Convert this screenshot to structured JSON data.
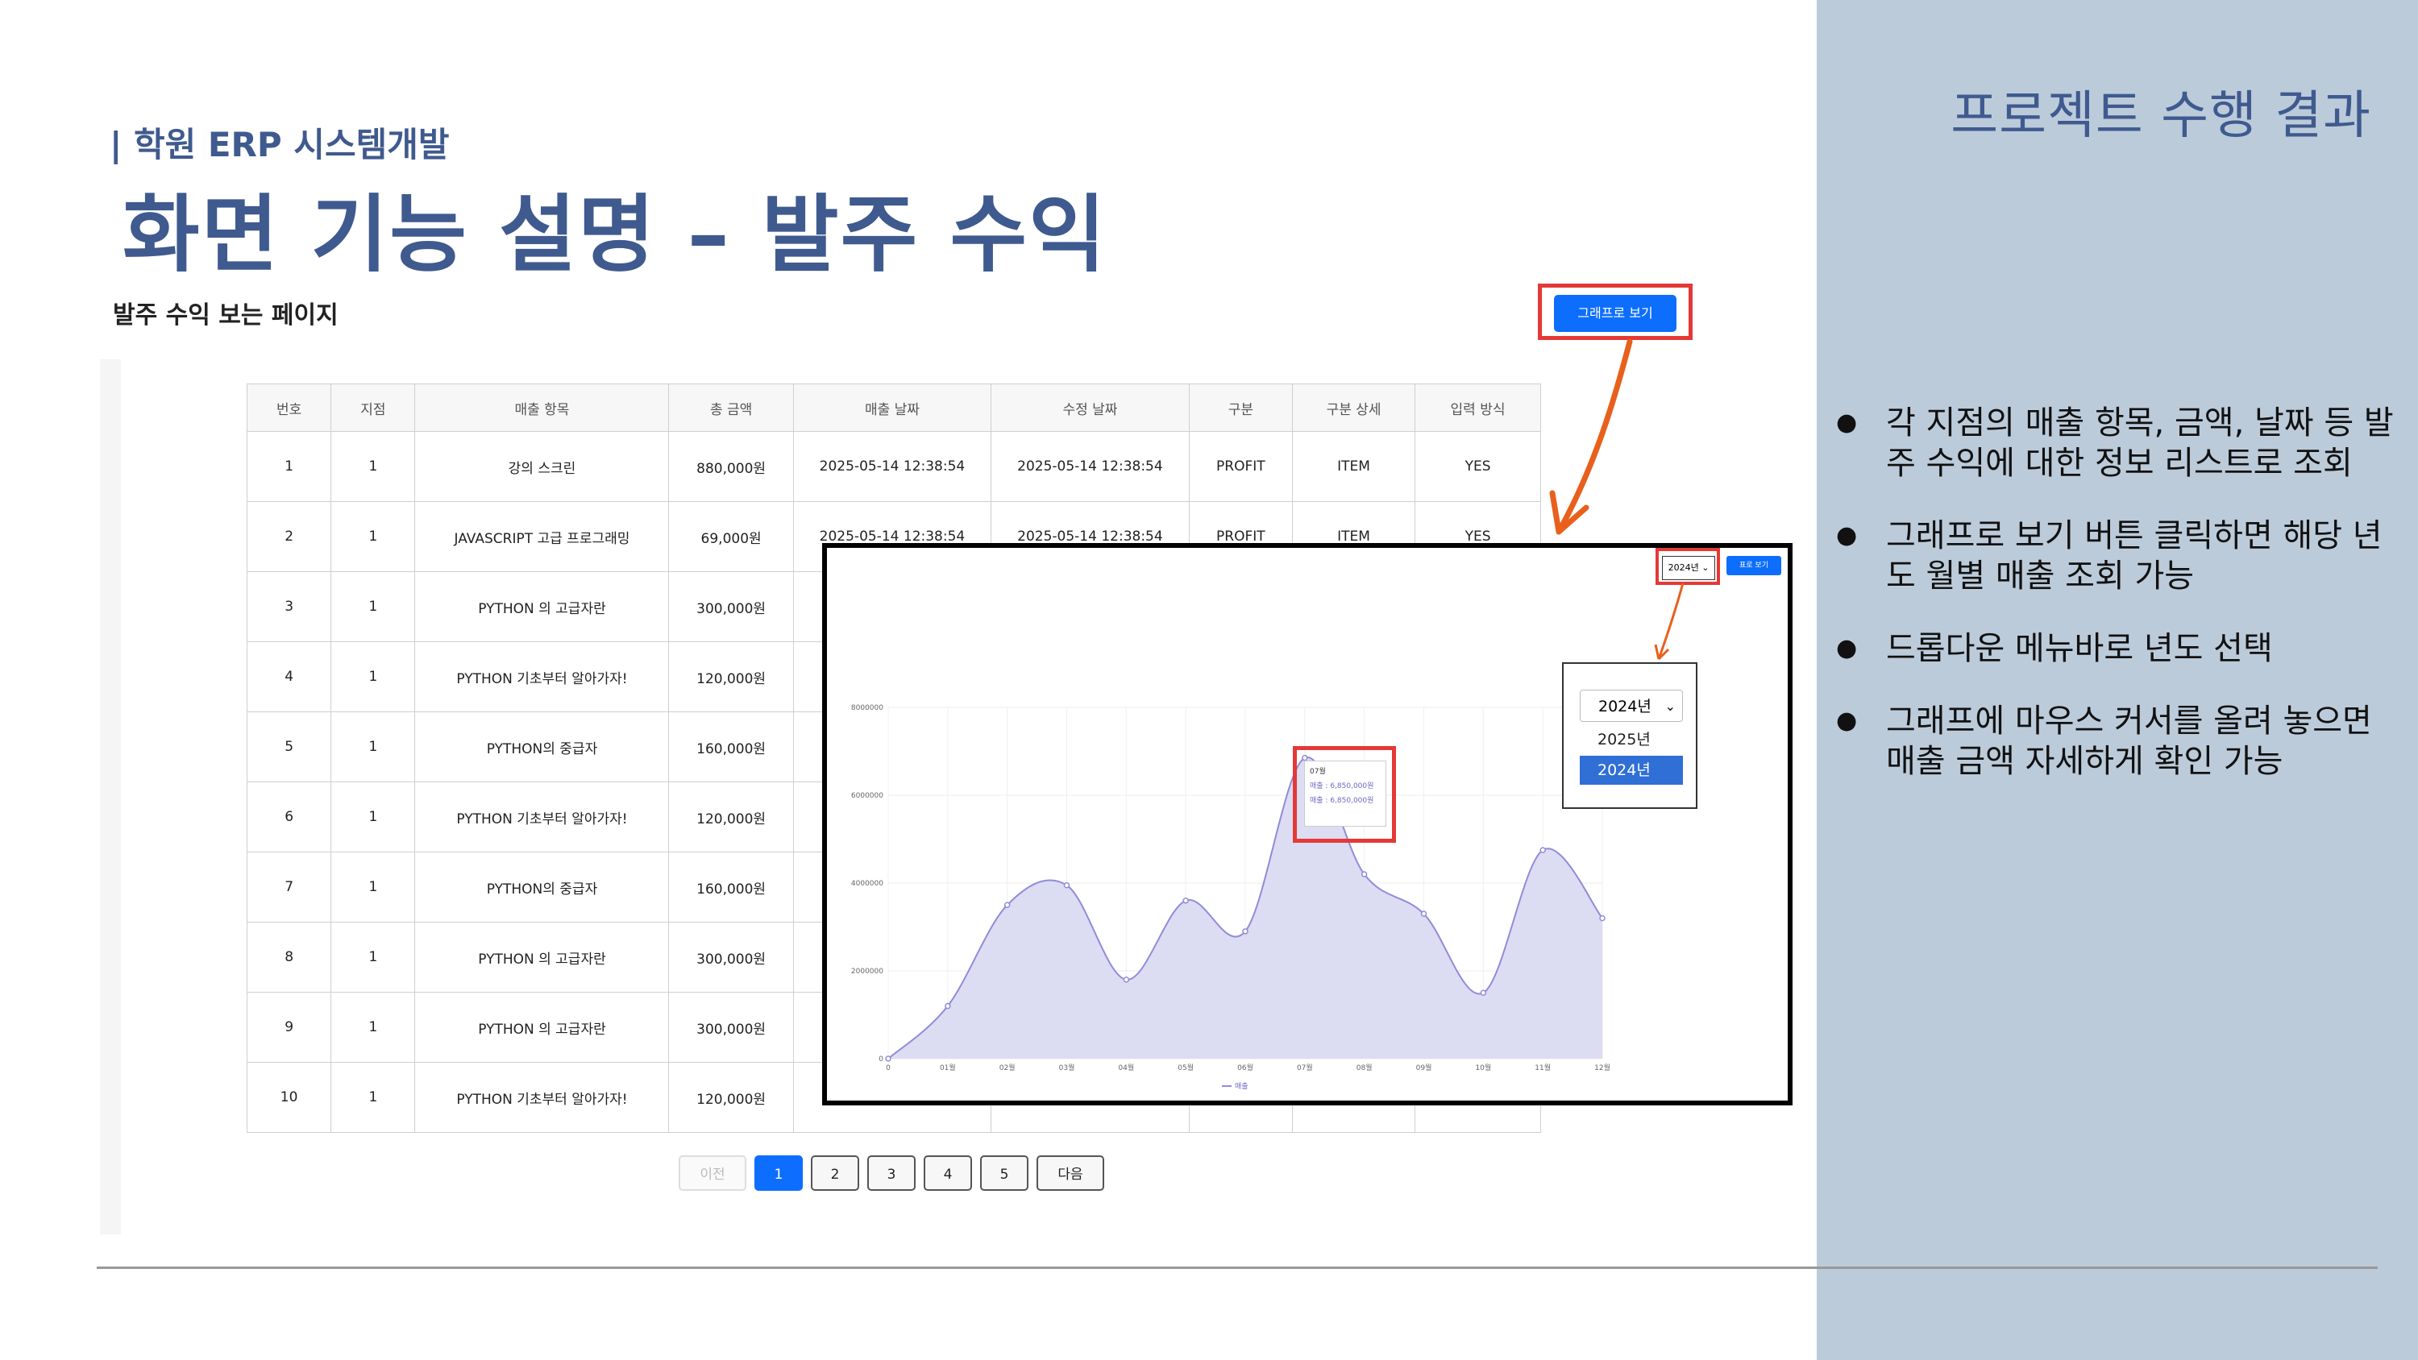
{
  "sidebar": {
    "title": "프로젝트 수행 결과",
    "bullets": [
      "각 지점의 매출 항목, 금액, 날짜 등 발주 수익에 대한 정보 리스트로 조회",
      "그래프로 보기 버튼 클릭하면 해당 년도 월별 매출 조회 가능",
      "드롭다운 메뉴바로 년도 선택",
      "그래프에 마우스 커서를 올려 놓으면 매출 금액 자세하게 확인 가능"
    ]
  },
  "header": {
    "subtitle": "| 학원 ERP 시스템개발",
    "title": "화면 기능 설명 – 발주 수익",
    "caption": "발주 수익 보는 페이지"
  },
  "toolbar": {
    "graph_button": "그래프로 보기"
  },
  "table": {
    "columns": [
      "번호",
      "지점",
      "매출 항목",
      "총 금액",
      "매출 날짜",
      "수정 날짜",
      "구분",
      "구분 상세",
      "입력 방식"
    ],
    "rows": [
      [
        "1",
        "1",
        "강의 스크린",
        "880,000원",
        "2025-05-14 12:38:54",
        "2025-05-14 12:38:54",
        "PROFIT",
        "ITEM",
        "YES"
      ],
      [
        "2",
        "1",
        "JAVASCRIPT 고급 프로그래밍",
        "69,000원",
        "2025-05-14 12:38:54",
        "2025-05-14 12:38:54",
        "PROFIT",
        "ITEM",
        "YES"
      ],
      [
        "3",
        "1",
        "PYTHON 의 고급자란",
        "300,000원",
        "",
        "",
        "",
        "",
        ""
      ],
      [
        "4",
        "1",
        "PYTHON 기초부터 알아가자!",
        "120,000원",
        "",
        "",
        "",
        "",
        ""
      ],
      [
        "5",
        "1",
        "PYTHON의 중급자",
        "160,000원",
        "",
        "",
        "",
        "",
        ""
      ],
      [
        "6",
        "1",
        "PYTHON 기초부터 알아가자!",
        "120,000원",
        "",
        "",
        "",
        "",
        ""
      ],
      [
        "7",
        "1",
        "PYTHON의 중급자",
        "160,000원",
        "",
        "",
        "",
        "",
        ""
      ],
      [
        "8",
        "1",
        "PYTHON 의 고급자란",
        "300,000원",
        "",
        "",
        "",
        "",
        ""
      ],
      [
        "9",
        "1",
        "PYTHON 의 고급자란",
        "300,000원",
        "",
        "",
        "",
        "",
        ""
      ],
      [
        "10",
        "1",
        "PYTHON 기초부터 알아가자!",
        "120,000원",
        "",
        "",
        "",
        "",
        ""
      ]
    ]
  },
  "pagination": {
    "prev": "이전",
    "pages": [
      "1",
      "2",
      "3",
      "4",
      "5"
    ],
    "active": "1",
    "next": "다음"
  },
  "popup": {
    "year_select": "2024년",
    "button": "표로 보기",
    "dropdown": {
      "selected": "2024년",
      "options": [
        "2025년",
        "2024년"
      ],
      "highlighted": "2024년"
    },
    "tooltip": {
      "title": "07월",
      "line1": "매출 : 6,850,000원",
      "line2": "매출 : 6,850,000원"
    }
  },
  "chart_data": {
    "type": "area",
    "categories": [
      "01월",
      "02월",
      "03월",
      "04월",
      "05월",
      "06월",
      "07월",
      "08월",
      "09월",
      "10월",
      "11월",
      "12월"
    ],
    "x_start_label": "0",
    "series": [
      {
        "name": "매출",
        "values": [
          0,
          1200000,
          3500000,
          3950000,
          1800000,
          3600000,
          2900000,
          6850000,
          4200000,
          3300000,
          1500000,
          4750000,
          3200000
        ]
      }
    ],
    "y_ticks": [
      "0",
      "2000000",
      "4000000",
      "6000000",
      "8000000"
    ],
    "ylim": [
      0,
      8000000
    ],
    "grid": true,
    "legend": "bottom",
    "fill_color": "#dcdcf3",
    "line_color": "#8f8cd8"
  },
  "colors": {
    "accent": "#3f5a8e",
    "sidebar_bg": "#bccbda",
    "primary": "#0d6efd",
    "highlight": "#e53935",
    "arrow": "#e8601c"
  }
}
